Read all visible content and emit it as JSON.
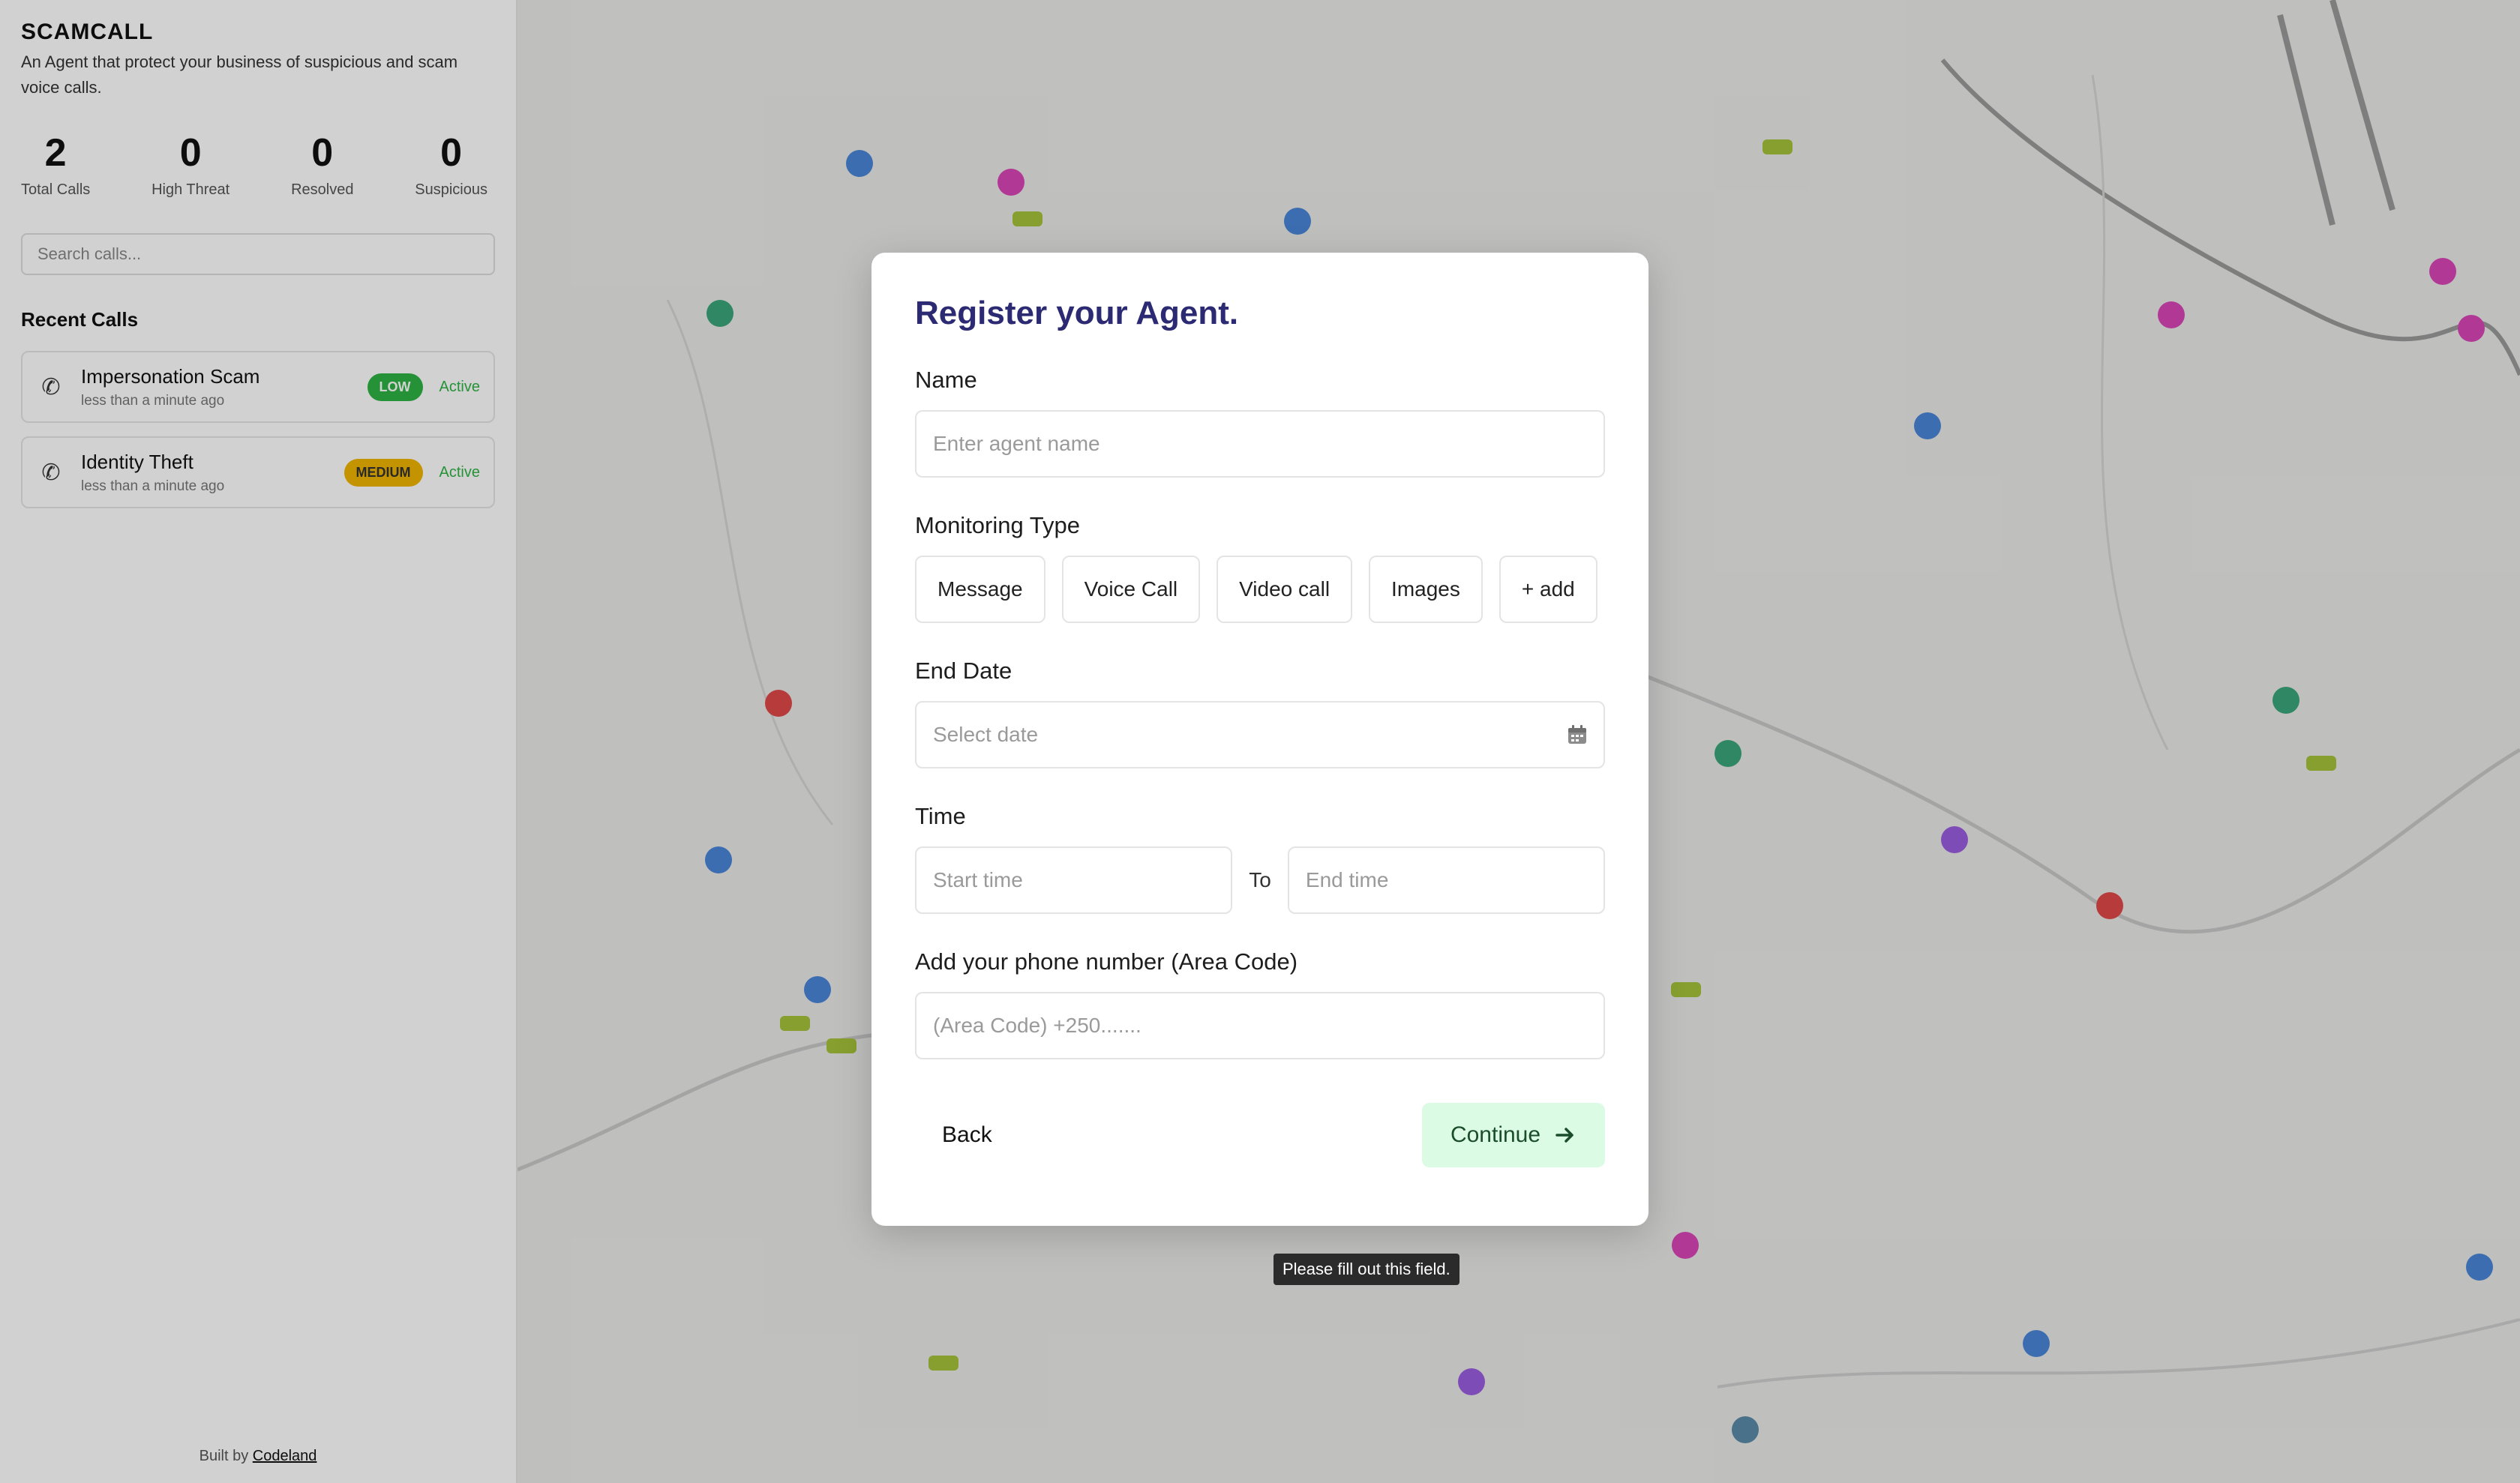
{
  "sidebar": {
    "brand": "SCAMCALL",
    "tagline": "An Agent that protect your business of suspicious and scam voice calls.",
    "stats": [
      {
        "value": "2",
        "label": "Total Calls"
      },
      {
        "value": "0",
        "label": "High Threat"
      },
      {
        "value": "0",
        "label": "Resolved"
      },
      {
        "value": "0",
        "label": "Suspicious"
      }
    ],
    "search_placeholder": "Search calls...",
    "recent_title": "Recent Calls",
    "calls": [
      {
        "title": "Impersonation Scam",
        "time": "less than a minute ago",
        "badge": "LOW",
        "status": "Active"
      },
      {
        "title": "Identity Theft",
        "time": "less than a minute ago",
        "badge": "MEDIUM",
        "status": "Active"
      }
    ],
    "footer_prefix": "Built by",
    "footer_link": "Codeland"
  },
  "modal": {
    "title": "Register your Agent.",
    "name_label": "Name",
    "name_placeholder": "Enter agent name",
    "monitoring_label": "Monitoring Type",
    "monitoring_options": [
      "Message",
      "Voice Call",
      "Video call",
      "Images",
      "+ add"
    ],
    "end_date_label": "End Date",
    "end_date_placeholder": "Select date",
    "time_label": "Time",
    "start_time_placeholder": "Start time",
    "to_label": "To",
    "end_time_placeholder": "End time",
    "phone_label": "Add your phone number (Area Code)",
    "phone_placeholder": "(Area Code) +250.......",
    "back_label": "Back",
    "continue_label": "Continue"
  },
  "tooltip": "Please fill out this field.",
  "colors": {
    "title": "#2b2a72",
    "continue_bg": "#dbfbe4",
    "badge_low": "#2fb344",
    "badge_medium": "#f0b400"
  }
}
